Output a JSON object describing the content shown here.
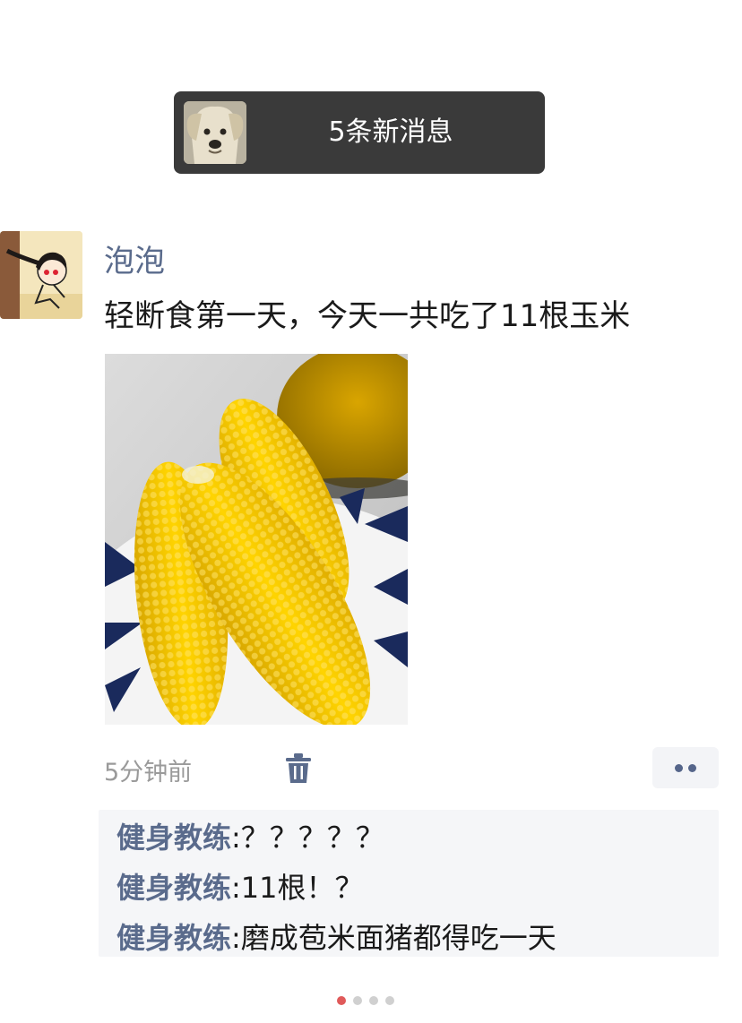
{
  "notice": {
    "text": "5条新消息",
    "avatar_icon": "dog-avatar-icon"
  },
  "post": {
    "author": "泡泡",
    "text": "轻断食第一天，今天一共吃了11根玉米",
    "photo_icon": "corn-photo",
    "time": "5分钟前",
    "delete_icon": "trash-icon",
    "more_icon": "more-dots-icon"
  },
  "comments": [
    {
      "author": "健身教练",
      "sep": ":",
      "text": "？？？？？"
    },
    {
      "author": "健身教练",
      "sep": ":",
      "text": "11根！？"
    },
    {
      "author": "健身教练",
      "sep": ":",
      "text": "磨成苞米面猪都得吃一天"
    }
  ],
  "pager": {
    "count": 4,
    "active": 0,
    "active_color": "#e05a5a"
  }
}
